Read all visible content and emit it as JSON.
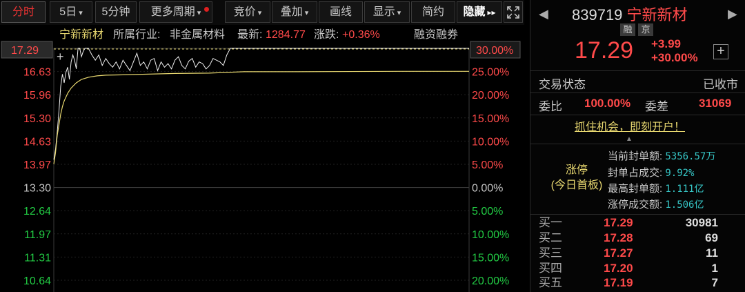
{
  "toolbar": {
    "tabs": [
      "分时",
      "5日",
      "5分钟",
      "更多周期"
    ],
    "tools": [
      "竞价",
      "叠加",
      "画线",
      "显示",
      "简约",
      "隐藏"
    ],
    "caret": "▾",
    "hide_arrows": "▸▸",
    "expand_icon": "fullscreen-icon"
  },
  "chart": {
    "stock_name": "宁新新材",
    "industry_label": "所属行业:",
    "industry": "非金属材料",
    "latest_label": "最新:",
    "latest": "1284.77",
    "change_label": "涨跌:",
    "change": "+0.36%",
    "margin_label": "融资融券",
    "crosshair_price": "17.29",
    "left_axis": [
      "17.29",
      "16.63",
      "15.96",
      "15.30",
      "14.63",
      "13.97",
      "13.30",
      "12.64",
      "11.97",
      "11.31",
      "10.64"
    ],
    "right_axis": [
      "30.00%",
      "25.00%",
      "20.00%",
      "15.00%",
      "10.00%",
      "5.00%",
      "0.00%",
      "5.00%",
      "10.00%",
      "15.00%",
      "20.00%"
    ],
    "price_series": [
      [
        0,
        14.1
      ],
      [
        1,
        14.4
      ],
      [
        2,
        14.9
      ],
      [
        3,
        15.5
      ],
      [
        4,
        16.2
      ],
      [
        5,
        16.55
      ],
      [
        6,
        16.3
      ],
      [
        7,
        16.6
      ],
      [
        8,
        16.75
      ],
      [
        9,
        16.4
      ],
      [
        10,
        16.9
      ],
      [
        11,
        17.1
      ],
      [
        12,
        16.95
      ],
      [
        13,
        16.7
      ],
      [
        14,
        17.29
      ],
      [
        15,
        17.29
      ],
      [
        16,
        17.05
      ],
      [
        17,
        17.2
      ],
      [
        18,
        17.29
      ],
      [
        19,
        17.29
      ],
      [
        20,
        17.29
      ],
      [
        22,
        17.1
      ],
      [
        24,
        16.95
      ],
      [
        26,
        17.1
      ],
      [
        28,
        16.8
      ],
      [
        30,
        17.0
      ],
      [
        32,
        16.85
      ],
      [
        34,
        16.75
      ],
      [
        36,
        16.9
      ],
      [
        38,
        16.7
      ],
      [
        40,
        16.95
      ],
      [
        42,
        16.8
      ],
      [
        44,
        16.65
      ],
      [
        46,
        16.9
      ],
      [
        48,
        17.15
      ],
      [
        50,
        16.8
      ],
      [
        52,
        16.9
      ],
      [
        54,
        16.7
      ],
      [
        56,
        16.95
      ],
      [
        58,
        17.0
      ],
      [
        60,
        16.65
      ],
      [
        62,
        16.9
      ],
      [
        64,
        16.75
      ],
      [
        66,
        16.85
      ],
      [
        68,
        16.7
      ],
      [
        70,
        16.95
      ],
      [
        72,
        17.05
      ],
      [
        74,
        16.8
      ],
      [
        76,
        16.7
      ],
      [
        78,
        16.92
      ],
      [
        80,
        17.0
      ],
      [
        82,
        16.75
      ],
      [
        84,
        16.9
      ],
      [
        86,
        16.85
      ],
      [
        88,
        16.7
      ],
      [
        90,
        16.8
      ],
      [
        92,
        17.0
      ],
      [
        94,
        16.95
      ],
      [
        96,
        16.9
      ],
      [
        98,
        16.8
      ],
      [
        100,
        17.1
      ],
      [
        102,
        17.29
      ],
      [
        240,
        17.29
      ]
    ],
    "avg_series": [
      [
        0,
        13.97
      ],
      [
        1,
        14.3
      ],
      [
        2,
        14.8
      ],
      [
        3,
        15.1
      ],
      [
        4,
        15.4
      ],
      [
        5,
        15.62
      ],
      [
        6,
        15.78
      ],
      [
        8,
        16.0
      ],
      [
        10,
        16.15
      ],
      [
        13,
        16.3
      ],
      [
        16,
        16.4
      ],
      [
        20,
        16.46
      ],
      [
        25,
        16.5
      ],
      [
        30,
        16.52
      ],
      [
        40,
        16.53
      ],
      [
        55,
        16.55
      ],
      [
        70,
        16.57
      ],
      [
        90,
        16.58
      ],
      [
        100,
        16.6
      ],
      [
        110,
        16.62
      ],
      [
        140,
        16.62
      ],
      [
        200,
        16.63
      ],
      [
        240,
        16.63
      ]
    ]
  },
  "panel": {
    "prev_icon": "◀",
    "next_icon": "▶",
    "code": "839719",
    "name": "宁新新材",
    "tags": [
      "融",
      "京"
    ],
    "price": "17.29",
    "change": "+3.99",
    "change_pct": "+30.00%",
    "add_icon": "+",
    "status_label": "交易状态",
    "status_value": "已收市",
    "ratio_label": "委比",
    "ratio_value": "100.00%",
    "diff_label": "委差",
    "diff_value": "31069",
    "promo": "抓住机会，即刻开户！",
    "collapse_icon": "▲",
    "limit_up": "涨停",
    "limit_sub": "(今日首板)",
    "seal_amount_label": "当前封单额:",
    "seal_amount": "5356.57万",
    "seal_ratio_label": "封单占成交:",
    "seal_ratio": "9.92%",
    "max_seal_label": "最高封单额:",
    "max_seal": "1.111亿",
    "limit_turnover_label": "涨停成交额:",
    "limit_turnover": "1.506亿",
    "bids": [
      {
        "label": "买一",
        "price": "17.29",
        "volume": "30981"
      },
      {
        "label": "买二",
        "price": "17.28",
        "volume": "69"
      },
      {
        "label": "买三",
        "price": "17.27",
        "volume": "11"
      },
      {
        "label": "买四",
        "price": "17.20",
        "volume": "1"
      },
      {
        "label": "买五",
        "price": "17.19",
        "volume": "7"
      }
    ]
  },
  "colors": {
    "up": "#ff4a4a",
    "down": "#22cc44",
    "avg": "#e8d870",
    "price_line": "#f0f0f0",
    "info": "#36c6c6"
  }
}
